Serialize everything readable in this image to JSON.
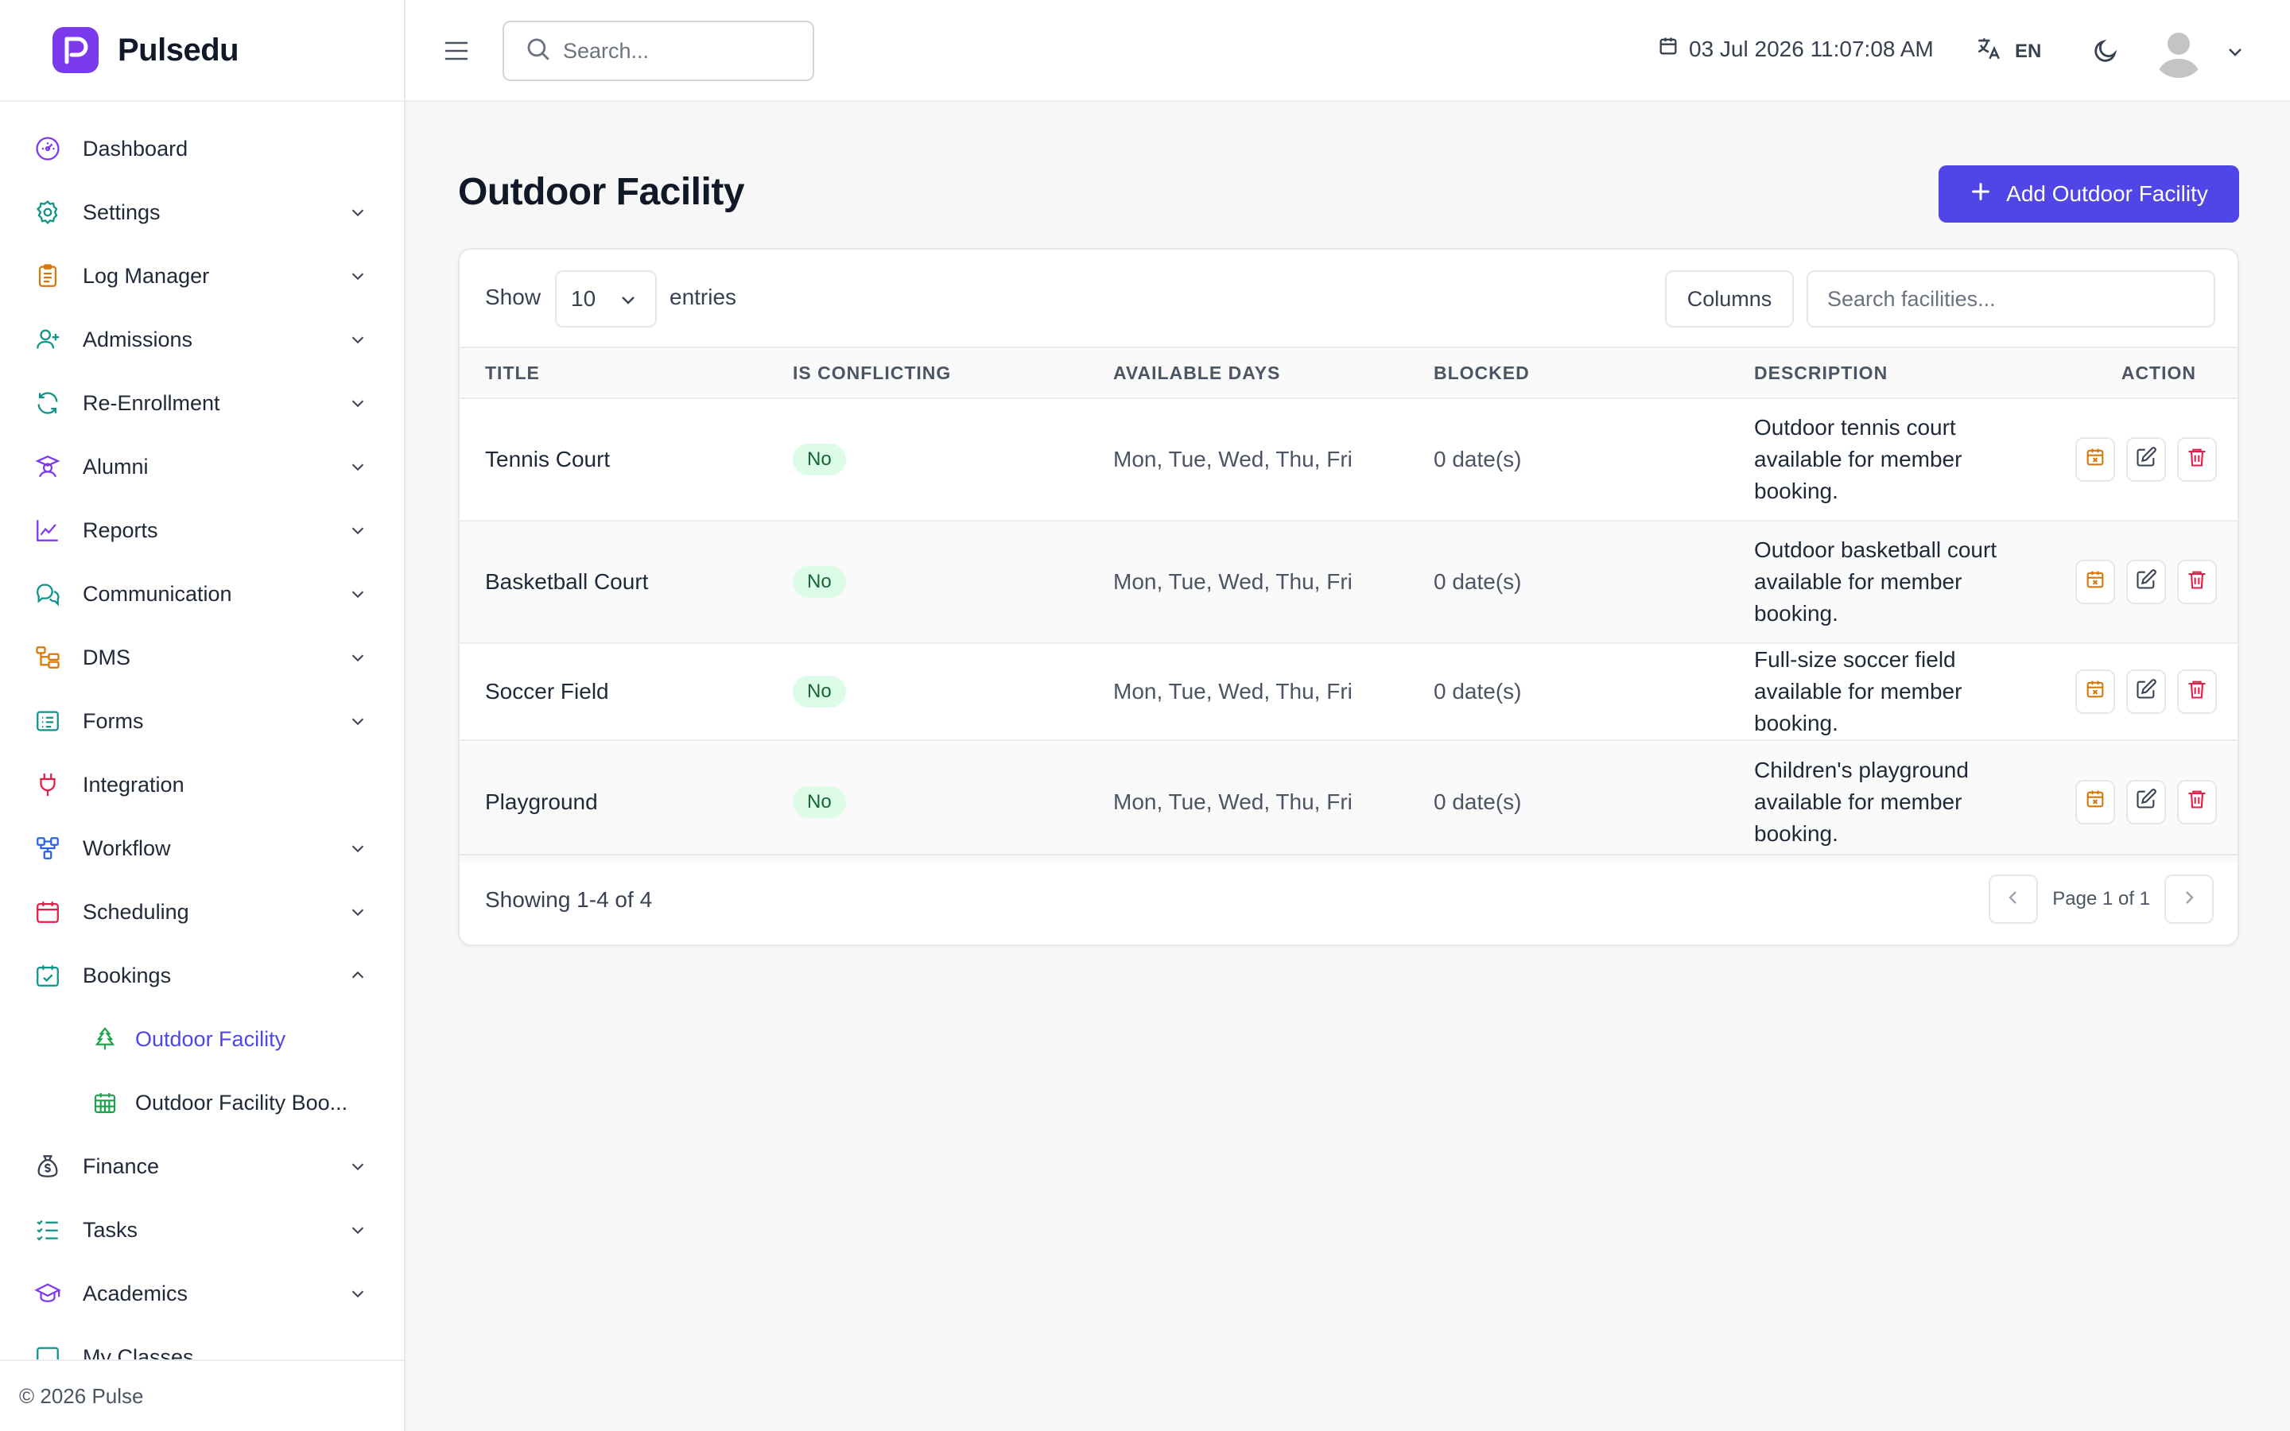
{
  "brand": {
    "name": "Pulsedu"
  },
  "sidebar": {
    "items": [
      {
        "label": "Dashboard",
        "icon": "dashboard-icon",
        "chevron": false
      },
      {
        "label": "Settings",
        "icon": "gear-icon",
        "chevron": true
      },
      {
        "label": "Log Manager",
        "icon": "clipboard-icon",
        "chevron": true
      },
      {
        "label": "Admissions",
        "icon": "user-plus-icon",
        "chevron": true
      },
      {
        "label": "Re-Enrollment",
        "icon": "refresh-icon",
        "chevron": true
      },
      {
        "label": "Alumni",
        "icon": "graduate-icon",
        "chevron": true
      },
      {
        "label": "Reports",
        "icon": "line-chart-icon",
        "chevron": true
      },
      {
        "label": "Communication",
        "icon": "chat-icon",
        "chevron": true
      },
      {
        "label": "DMS",
        "icon": "folder-tree-icon",
        "chevron": true
      },
      {
        "label": "Forms",
        "icon": "form-icon",
        "chevron": true
      },
      {
        "label": "Integration",
        "icon": "plug-icon",
        "chevron": false
      },
      {
        "label": "Workflow",
        "icon": "workflow-icon",
        "chevron": true
      },
      {
        "label": "Scheduling",
        "icon": "calendar-icon",
        "chevron": true
      },
      {
        "label": "Bookings",
        "icon": "calendar-check-icon",
        "chevron": true,
        "expanded": true
      },
      {
        "label": "Outdoor Facility",
        "icon": "tree-icon",
        "sub": true,
        "active": true
      },
      {
        "label": "Outdoor Facility Boo...",
        "icon": "calendar-grid-icon",
        "sub": true
      },
      {
        "label": "Finance",
        "icon": "money-bag-icon",
        "chevron": true
      },
      {
        "label": "Tasks",
        "icon": "checklist-icon",
        "chevron": true
      },
      {
        "label": "Academics",
        "icon": "mortarboard-icon",
        "chevron": true
      },
      {
        "label": "My Classes",
        "icon": "monitor-icon",
        "chevron": false
      }
    ],
    "footer": "© 2026 Pulse"
  },
  "topbar": {
    "search_placeholder": "Search...",
    "datetime": "03 Jul 2026 11:07:08 AM",
    "language": "EN"
  },
  "page": {
    "title": "Outdoor Facility",
    "add_button": "Add Outdoor Facility"
  },
  "table": {
    "show_label": "Show",
    "entries_value": "10",
    "entries_label": "entries",
    "columns_button": "Columns",
    "search_placeholder": "Search facilities...",
    "headers": [
      "TITLE",
      "IS CONFLICTING",
      "AVAILABLE DAYS",
      "BLOCKED",
      "DESCRIPTION",
      "ACTION"
    ],
    "rows": [
      {
        "title": "Tennis Court",
        "conflicting": "No",
        "days": "Mon, Tue, Wed, Thu, Fri",
        "blocked": "0 date(s)",
        "description": "Outdoor tennis court available for member booking."
      },
      {
        "title": "Basketball Court",
        "conflicting": "No",
        "days": "Mon, Tue, Wed, Thu, Fri",
        "blocked": "0 date(s)",
        "description": "Outdoor basketball court available for member booking."
      },
      {
        "title": "Soccer Field",
        "conflicting": "No",
        "days": "Mon, Tue, Wed, Thu, Fri",
        "blocked": "0 date(s)",
        "description": "Full-size soccer field available for member booking."
      },
      {
        "title": "Playground",
        "conflicting": "No",
        "days": "Mon, Tue, Wed, Thu, Fri",
        "blocked": "0 date(s)",
        "description": "Children's playground available for member booking."
      }
    ],
    "showing": "Showing 1-4 of 4",
    "page_label": "Page 1 of 1"
  },
  "colors": {
    "accent": "#4f46e5",
    "badge_bg": "#dcfce7",
    "badge_text": "#166534",
    "block_icon": "#d97706",
    "delete_icon": "#e11d48"
  }
}
